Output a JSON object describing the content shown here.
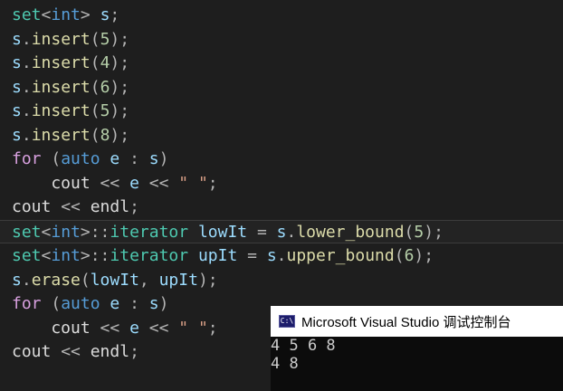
{
  "editor": {
    "colors": {
      "background": "#1e1e1e",
      "type": "#4ec9b0",
      "keyword": "#569cd6",
      "control": "#d8a0df",
      "variable": "#9cdcfe",
      "function": "#dcdcaa",
      "number": "#b5cea8",
      "string": "#d69d85"
    },
    "lines": [
      {
        "highlight": false,
        "tokens": [
          {
            "t": "set",
            "c": "type"
          },
          {
            "t": "<",
            "c": "punc"
          },
          {
            "t": "int",
            "c": "key"
          },
          {
            "t": "> ",
            "c": "punc"
          },
          {
            "t": "s",
            "c": "var"
          },
          {
            "t": ";",
            "c": "punc"
          }
        ]
      },
      {
        "highlight": false,
        "tokens": [
          {
            "t": "s",
            "c": "var"
          },
          {
            "t": ".",
            "c": "punc"
          },
          {
            "t": "insert",
            "c": "func"
          },
          {
            "t": "(",
            "c": "punc"
          },
          {
            "t": "5",
            "c": "num"
          },
          {
            "t": ");",
            "c": "punc"
          }
        ]
      },
      {
        "highlight": false,
        "tokens": [
          {
            "t": "s",
            "c": "var"
          },
          {
            "t": ".",
            "c": "punc"
          },
          {
            "t": "insert",
            "c": "func"
          },
          {
            "t": "(",
            "c": "punc"
          },
          {
            "t": "4",
            "c": "num"
          },
          {
            "t": ");",
            "c": "punc"
          }
        ]
      },
      {
        "highlight": false,
        "tokens": [
          {
            "t": "s",
            "c": "var"
          },
          {
            "t": ".",
            "c": "punc"
          },
          {
            "t": "insert",
            "c": "func"
          },
          {
            "t": "(",
            "c": "punc"
          },
          {
            "t": "6",
            "c": "num"
          },
          {
            "t": ");",
            "c": "punc"
          }
        ]
      },
      {
        "highlight": false,
        "tokens": [
          {
            "t": "s",
            "c": "var"
          },
          {
            "t": ".",
            "c": "punc"
          },
          {
            "t": "insert",
            "c": "func"
          },
          {
            "t": "(",
            "c": "punc"
          },
          {
            "t": "5",
            "c": "num"
          },
          {
            "t": ");",
            "c": "punc"
          }
        ]
      },
      {
        "highlight": false,
        "tokens": [
          {
            "t": "s",
            "c": "var"
          },
          {
            "t": ".",
            "c": "punc"
          },
          {
            "t": "insert",
            "c": "func"
          },
          {
            "t": "(",
            "c": "punc"
          },
          {
            "t": "8",
            "c": "num"
          },
          {
            "t": ");",
            "c": "punc"
          }
        ]
      },
      {
        "highlight": false,
        "tokens": [
          {
            "t": "for",
            "c": "ctl"
          },
          {
            "t": " (",
            "c": "punc"
          },
          {
            "t": "auto",
            "c": "key"
          },
          {
            "t": " ",
            "c": "plain"
          },
          {
            "t": "e",
            "c": "var"
          },
          {
            "t": " : ",
            "c": "punc"
          },
          {
            "t": "s",
            "c": "var"
          },
          {
            "t": ")",
            "c": "punc"
          }
        ]
      },
      {
        "highlight": false,
        "tokens": [
          {
            "t": "    cout",
            "c": "plain"
          },
          {
            "t": " << ",
            "c": "punc"
          },
          {
            "t": "e",
            "c": "var"
          },
          {
            "t": " << ",
            "c": "punc"
          },
          {
            "t": "\" \"",
            "c": "str"
          },
          {
            "t": ";",
            "c": "punc"
          }
        ]
      },
      {
        "highlight": false,
        "tokens": [
          {
            "t": "cout",
            "c": "plain"
          },
          {
            "t": " << ",
            "c": "punc"
          },
          {
            "t": "endl",
            "c": "plain"
          },
          {
            "t": ";",
            "c": "punc"
          }
        ]
      },
      {
        "highlight": true,
        "tokens": [
          {
            "t": "set",
            "c": "type"
          },
          {
            "t": "<",
            "c": "punc"
          },
          {
            "t": "int",
            "c": "key"
          },
          {
            "t": ">::",
            "c": "punc"
          },
          {
            "t": "iterator",
            "c": "type"
          },
          {
            "t": " ",
            "c": "plain"
          },
          {
            "t": "lowIt",
            "c": "var"
          },
          {
            "t": " = ",
            "c": "punc"
          },
          {
            "t": "s",
            "c": "var"
          },
          {
            "t": ".",
            "c": "punc"
          },
          {
            "t": "lower_bound",
            "c": "func"
          },
          {
            "t": "(",
            "c": "punc"
          },
          {
            "t": "5",
            "c": "num"
          },
          {
            "t": ");",
            "c": "punc"
          }
        ]
      },
      {
        "highlight": false,
        "tokens": [
          {
            "t": "set",
            "c": "type"
          },
          {
            "t": "<",
            "c": "punc"
          },
          {
            "t": "int",
            "c": "key"
          },
          {
            "t": ">::",
            "c": "punc"
          },
          {
            "t": "iterator",
            "c": "type"
          },
          {
            "t": " ",
            "c": "plain"
          },
          {
            "t": "upIt",
            "c": "var"
          },
          {
            "t": " = ",
            "c": "punc"
          },
          {
            "t": "s",
            "c": "var"
          },
          {
            "t": ".",
            "c": "punc"
          },
          {
            "t": "upper_bound",
            "c": "func"
          },
          {
            "t": "(",
            "c": "punc"
          },
          {
            "t": "6",
            "c": "num"
          },
          {
            "t": ");",
            "c": "punc"
          }
        ]
      },
      {
        "highlight": false,
        "tokens": [
          {
            "t": "s",
            "c": "var"
          },
          {
            "t": ".",
            "c": "punc"
          },
          {
            "t": "erase",
            "c": "func"
          },
          {
            "t": "(",
            "c": "punc"
          },
          {
            "t": "lowIt",
            "c": "var"
          },
          {
            "t": ", ",
            "c": "punc"
          },
          {
            "t": "upIt",
            "c": "var"
          },
          {
            "t": ");",
            "c": "punc"
          }
        ]
      },
      {
        "highlight": false,
        "tokens": [
          {
            "t": "for",
            "c": "ctl"
          },
          {
            "t": " (",
            "c": "punc"
          },
          {
            "t": "auto",
            "c": "key"
          },
          {
            "t": " ",
            "c": "plain"
          },
          {
            "t": "e",
            "c": "var"
          },
          {
            "t": " : ",
            "c": "punc"
          },
          {
            "t": "s",
            "c": "var"
          },
          {
            "t": ")",
            "c": "punc"
          }
        ]
      },
      {
        "highlight": false,
        "tokens": [
          {
            "t": "    cout",
            "c": "plain"
          },
          {
            "t": " << ",
            "c": "punc"
          },
          {
            "t": "e",
            "c": "var"
          },
          {
            "t": " << ",
            "c": "punc"
          },
          {
            "t": "\" \"",
            "c": "str"
          },
          {
            "t": ";",
            "c": "punc"
          }
        ]
      },
      {
        "highlight": false,
        "tokens": [
          {
            "t": "cout",
            "c": "plain"
          },
          {
            "t": " << ",
            "c": "punc"
          },
          {
            "t": "endl",
            "c": "plain"
          },
          {
            "t": ";",
            "c": "punc"
          }
        ]
      }
    ]
  },
  "console": {
    "icon_label": "C:\\",
    "icon_name": "console-app-icon",
    "title": "Microsoft Visual Studio 调试控制台",
    "output": [
      "4 5 6 8",
      "4 8"
    ]
  }
}
